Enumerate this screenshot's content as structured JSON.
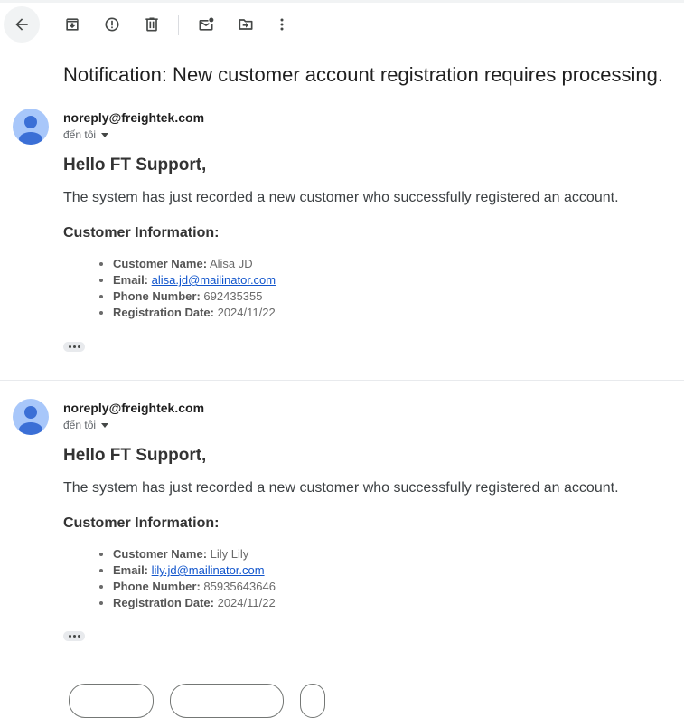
{
  "toolbar": {
    "buttons": [
      {
        "icon": "back-arrow-icon"
      },
      {
        "icon": "archive-icon"
      },
      {
        "icon": "report-spam-icon"
      },
      {
        "icon": "delete-icon"
      },
      {
        "icon": "mark-unread-icon"
      },
      {
        "icon": "move-to-icon"
      },
      {
        "icon": "more-vert-icon"
      }
    ]
  },
  "subject": "Notification: New customer account registration requires processing.",
  "messages": [
    {
      "sender": "noreply@freightek.com",
      "recipient": "đến tôi",
      "greeting": "Hello FT Support,",
      "intro": "The system has just recorded a new customer who successfully registered an account.",
      "info_heading": "Customer Information:",
      "labels": {
        "name": "Customer Name:",
        "email": "Email:",
        "phone": "Phone Number:",
        "date": "Registration Date:"
      },
      "name": "Alisa JD",
      "email": "alisa.jd@mailinator.com",
      "phone": "692435355",
      "date": "2024/11/22"
    },
    {
      "sender": "noreply@freightek.com",
      "recipient": "đến tôi",
      "greeting": "Hello FT Support,",
      "intro": "The system has just recorded a new customer who successfully registered an account.",
      "info_heading": "Customer Information:",
      "labels": {
        "name": "Customer Name:",
        "email": "Email:",
        "phone": "Phone Number:",
        "date": "Registration Date:"
      },
      "name": "Lily Lily",
      "email": "lily.jd@mailinator.com",
      "phone": "85935643646",
      "date": "2024/11/22"
    }
  ],
  "colors": {
    "avatar_bg": "#a8c7fa",
    "avatar_fg": "#3b6fd6",
    "link": "#1155cc"
  }
}
